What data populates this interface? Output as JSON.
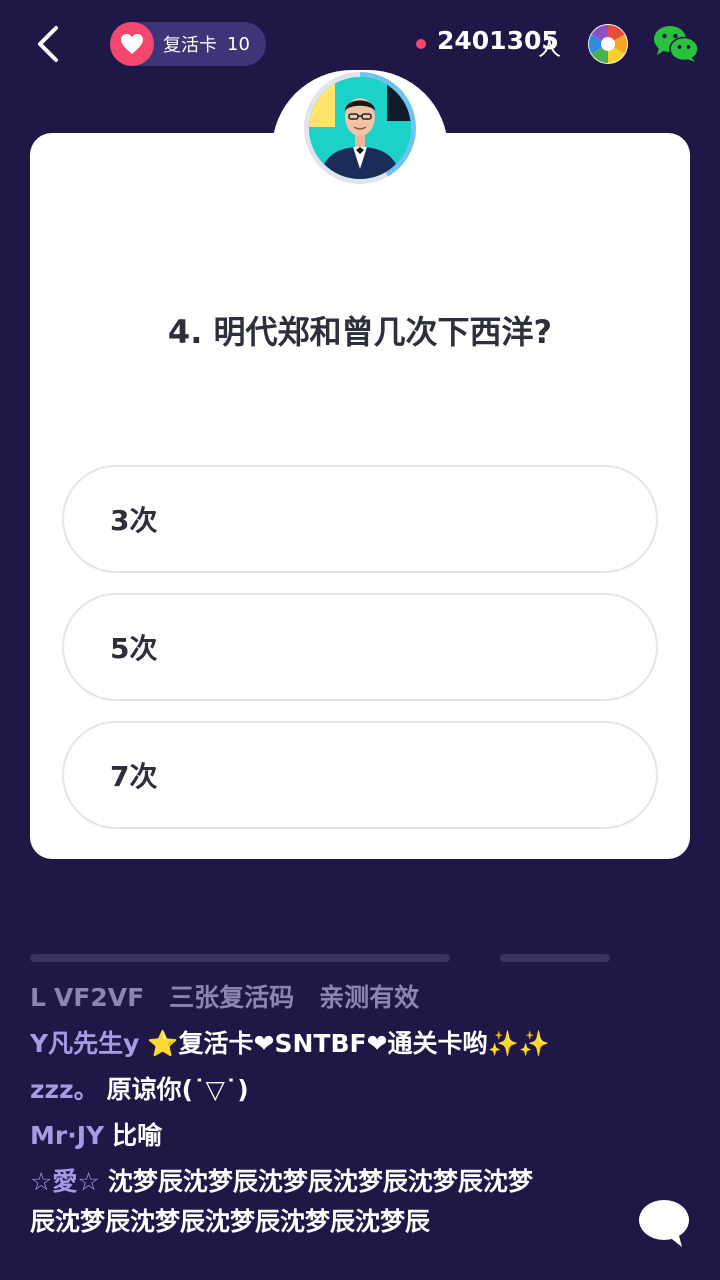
{
  "topbar": {
    "revive_label": "复活卡",
    "revive_count": "10",
    "online_count": "2401305",
    "online_unit": "人"
  },
  "colors": {
    "background": "#1f1846",
    "accent_pink": "#f3476d",
    "pill": "#3e3478",
    "card": "#ffffff",
    "username": "#a79be6"
  },
  "icons": {
    "back": "back-arrow-icon",
    "revive": "heart-icon",
    "photo": "camera-aperture-icon",
    "share": "wechat-icon",
    "chat": "chat-bubble-icon"
  },
  "question": {
    "text": "4. 明代郑和曾几次下西洋?",
    "options": [
      "3次",
      "5次",
      "7次"
    ]
  },
  "comments": [
    {
      "name": "L",
      "text": "VF2VF　三张复活码　亲测有效"
    },
    {
      "name": "Y凡先生y",
      "text": "⭐复活卡❤SNTBF❤通关卡哟✨✨"
    },
    {
      "name": "zzz。",
      "text": "原谅你(˙▽˙)"
    },
    {
      "name": "Mr·JY",
      "text": "比喻"
    },
    {
      "name": "☆愛☆",
      "text": "沈梦辰沈梦辰沈梦辰沈梦辰沈梦辰沈梦"
    },
    {
      "name": "",
      "text": "辰沈梦辰沈梦辰沈梦辰沈梦辰沈梦辰"
    }
  ]
}
